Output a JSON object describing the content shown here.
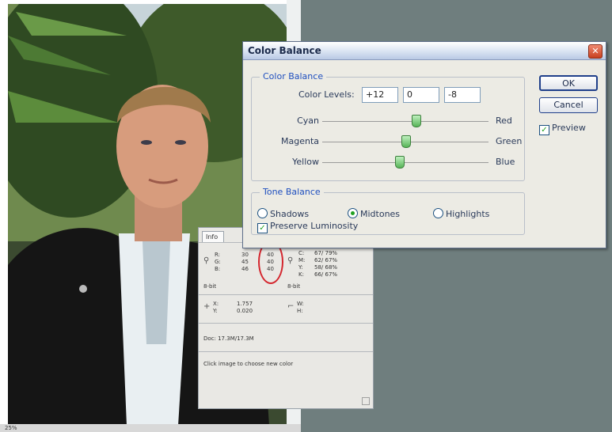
{
  "colors": {
    "accent_blue": "#1f4fbf",
    "slider_thumb": "#56b456",
    "highlight_red": "#d4252d",
    "workspace_gray": "#6f7e7e"
  },
  "color_balance_dialog": {
    "title": "Color Balance",
    "close_icon": "close-icon",
    "color_balance_group": {
      "legend": "Color Balance",
      "color_levels_label": "Color Levels:",
      "levels": [
        "+12",
        "0",
        "-8"
      ],
      "sliders": [
        {
          "left": "Cyan",
          "right": "Red",
          "value": 12
        },
        {
          "left": "Magenta",
          "right": "Green",
          "value": 0
        },
        {
          "left": "Yellow",
          "right": "Blue",
          "value": -8
        }
      ]
    },
    "tone_balance_group": {
      "legend": "Tone Balance",
      "shadows": "Shadows",
      "midtones": "Midtones",
      "highlights": "Highlights",
      "selected": "Midtones",
      "preserve_luminosity": "Preserve Luminosity",
      "preserve_checked": true
    },
    "ok_label": "OK",
    "cancel_label": "Cancel",
    "preview_label": "Preview",
    "preview_checked": true
  },
  "info_panel": {
    "tab_label": "Info",
    "rgb_labels": "R:\nG:\nB:",
    "rgb_values": "30\n45\n46",
    "rgb_after": "40\n40\n40",
    "cmyk_labels": "C:\nM:\nY:\nK:",
    "cmyk_values": "67/ 79%\n62/ 67%\n58/ 68%\n66/ 67%",
    "bit_left": "8-bit",
    "bit_right": "8-bit",
    "xy_labels": "X:\nY:",
    "xy_values": "1.757\n0.020",
    "wh_labels": "W:\nH:",
    "doc_info": "Doc: 17.3M/17.3M",
    "hint": "Click image to choose new color"
  },
  "status_bar": {
    "zoom_text": "25%"
  }
}
